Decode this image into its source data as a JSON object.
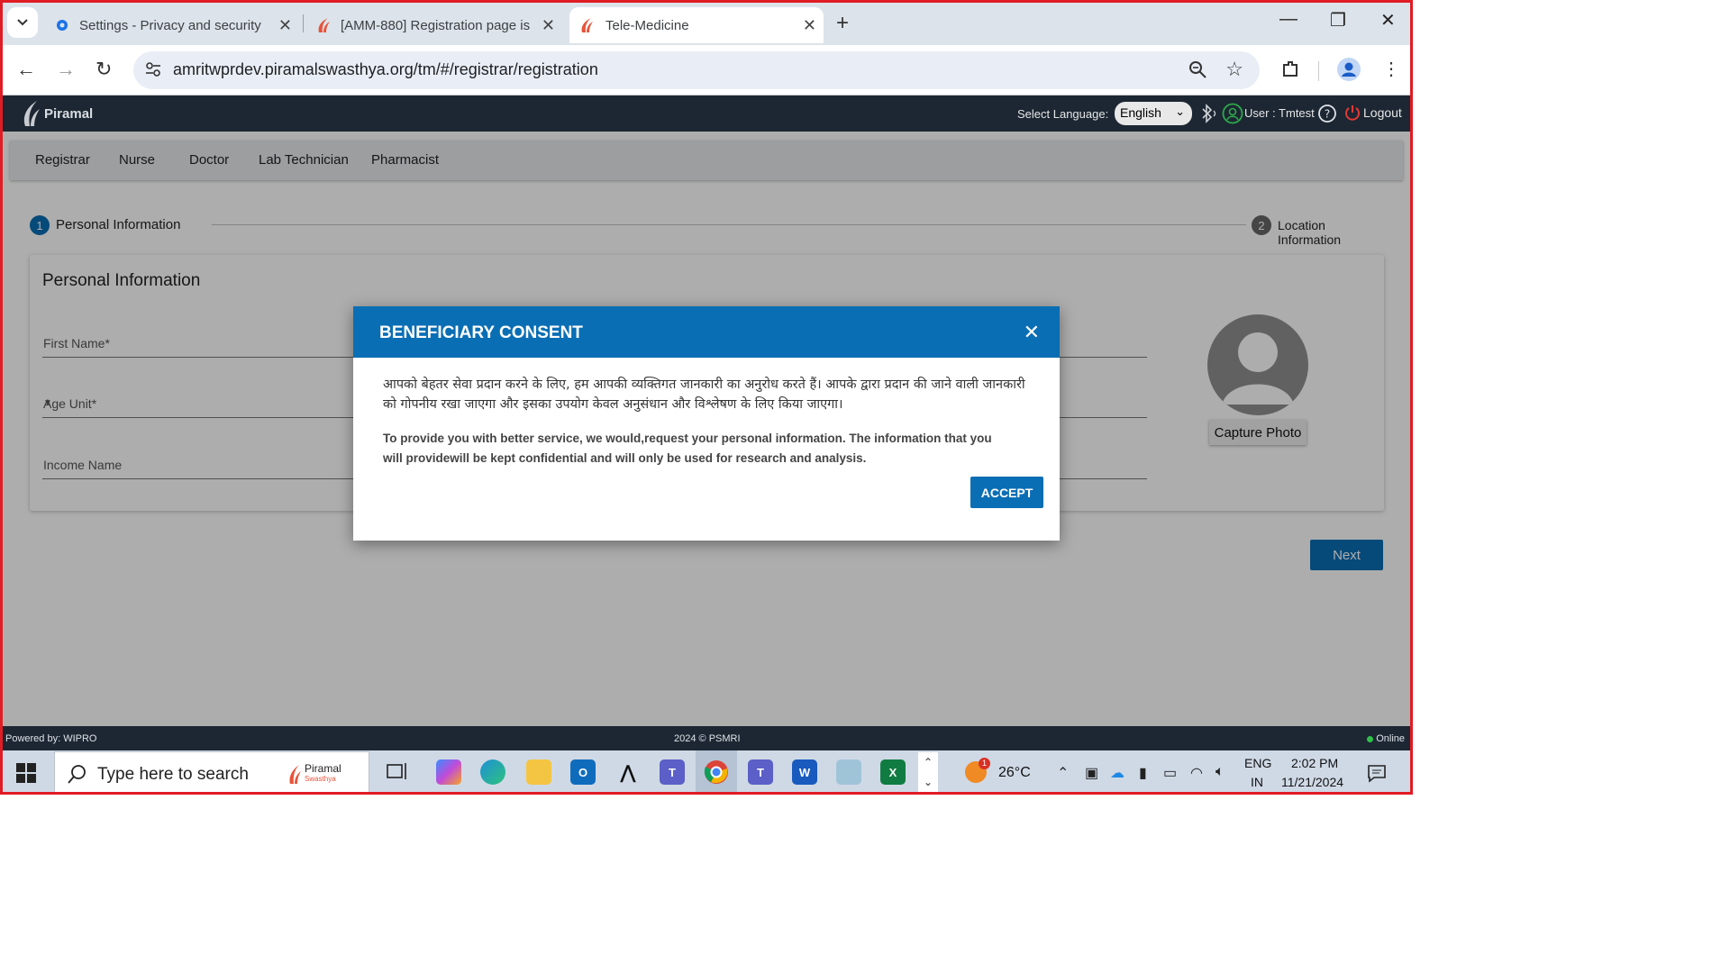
{
  "browser": {
    "tabs": [
      {
        "title": "Settings - Privacy and security",
        "icon": "gear-icon"
      },
      {
        "title": "[AMM-880] Registration page is",
        "icon": "piramal-logo-icon"
      },
      {
        "title": "Tele-Medicine",
        "icon": "piramal-logo-icon",
        "active": true
      }
    ],
    "url": "amritwprdev.piramalswasthya.org/tm/#/registrar/registration"
  },
  "app_header": {
    "brand": "Piramal",
    "language_label": "Select Language:",
    "language_value": "English",
    "user_text": "User : Tmtest",
    "logout_label": "Logout"
  },
  "menu": [
    "Registrar",
    "Nurse",
    "Doctor",
    "Lab Technician",
    "Pharmacist"
  ],
  "stepper": {
    "steps": [
      {
        "num": "1",
        "label": "Personal Information"
      },
      {
        "num": "2",
        "label": "Location Information"
      }
    ]
  },
  "form": {
    "title": "Personal Information",
    "fields": [
      {
        "label": "First Name*"
      },
      {
        "label": "Age Unit*"
      },
      {
        "label": "Income Name"
      }
    ],
    "capture_photo": "Capture Photo",
    "next_label": "Next"
  },
  "modal": {
    "title": "BENEFICIARY CONSENT",
    "hindi_text": "आपको बेहतर सेवा प्रदान करने के लिए, हम आपकी व्यक्तिगत जानकारी का अनुरोध करते हैं। आपके द्वारा प्रदान की जाने वाली जानकारी को गोपनीय रखा जाएगा और इसका उपयोग केवल अनुसंधान और विश्लेषण के लिए किया जाएगा।",
    "english_text": "To provide you with better service, we would,request your personal information. The information that you will providewill be kept confidential and will only be used for research and analysis.",
    "accept_label": "ACCEPT"
  },
  "footer": {
    "powered_by": "Powered by: WIPRO",
    "copyright": "2024 © PSMRI",
    "status": "Online"
  },
  "taskbar": {
    "search_placeholder": "Type here to search",
    "search_brand": "Piramal",
    "search_brand_sub": "Swasthya",
    "weather_badge": "1",
    "temperature": "26°C",
    "lang_top": "ENG",
    "lang_bottom": "IN",
    "time": "2:02 PM",
    "date": "11/21/2024"
  },
  "colors": {
    "primary": "#0a6eb4",
    "header_bg": "#1c2733",
    "frame": "#e01c24"
  }
}
